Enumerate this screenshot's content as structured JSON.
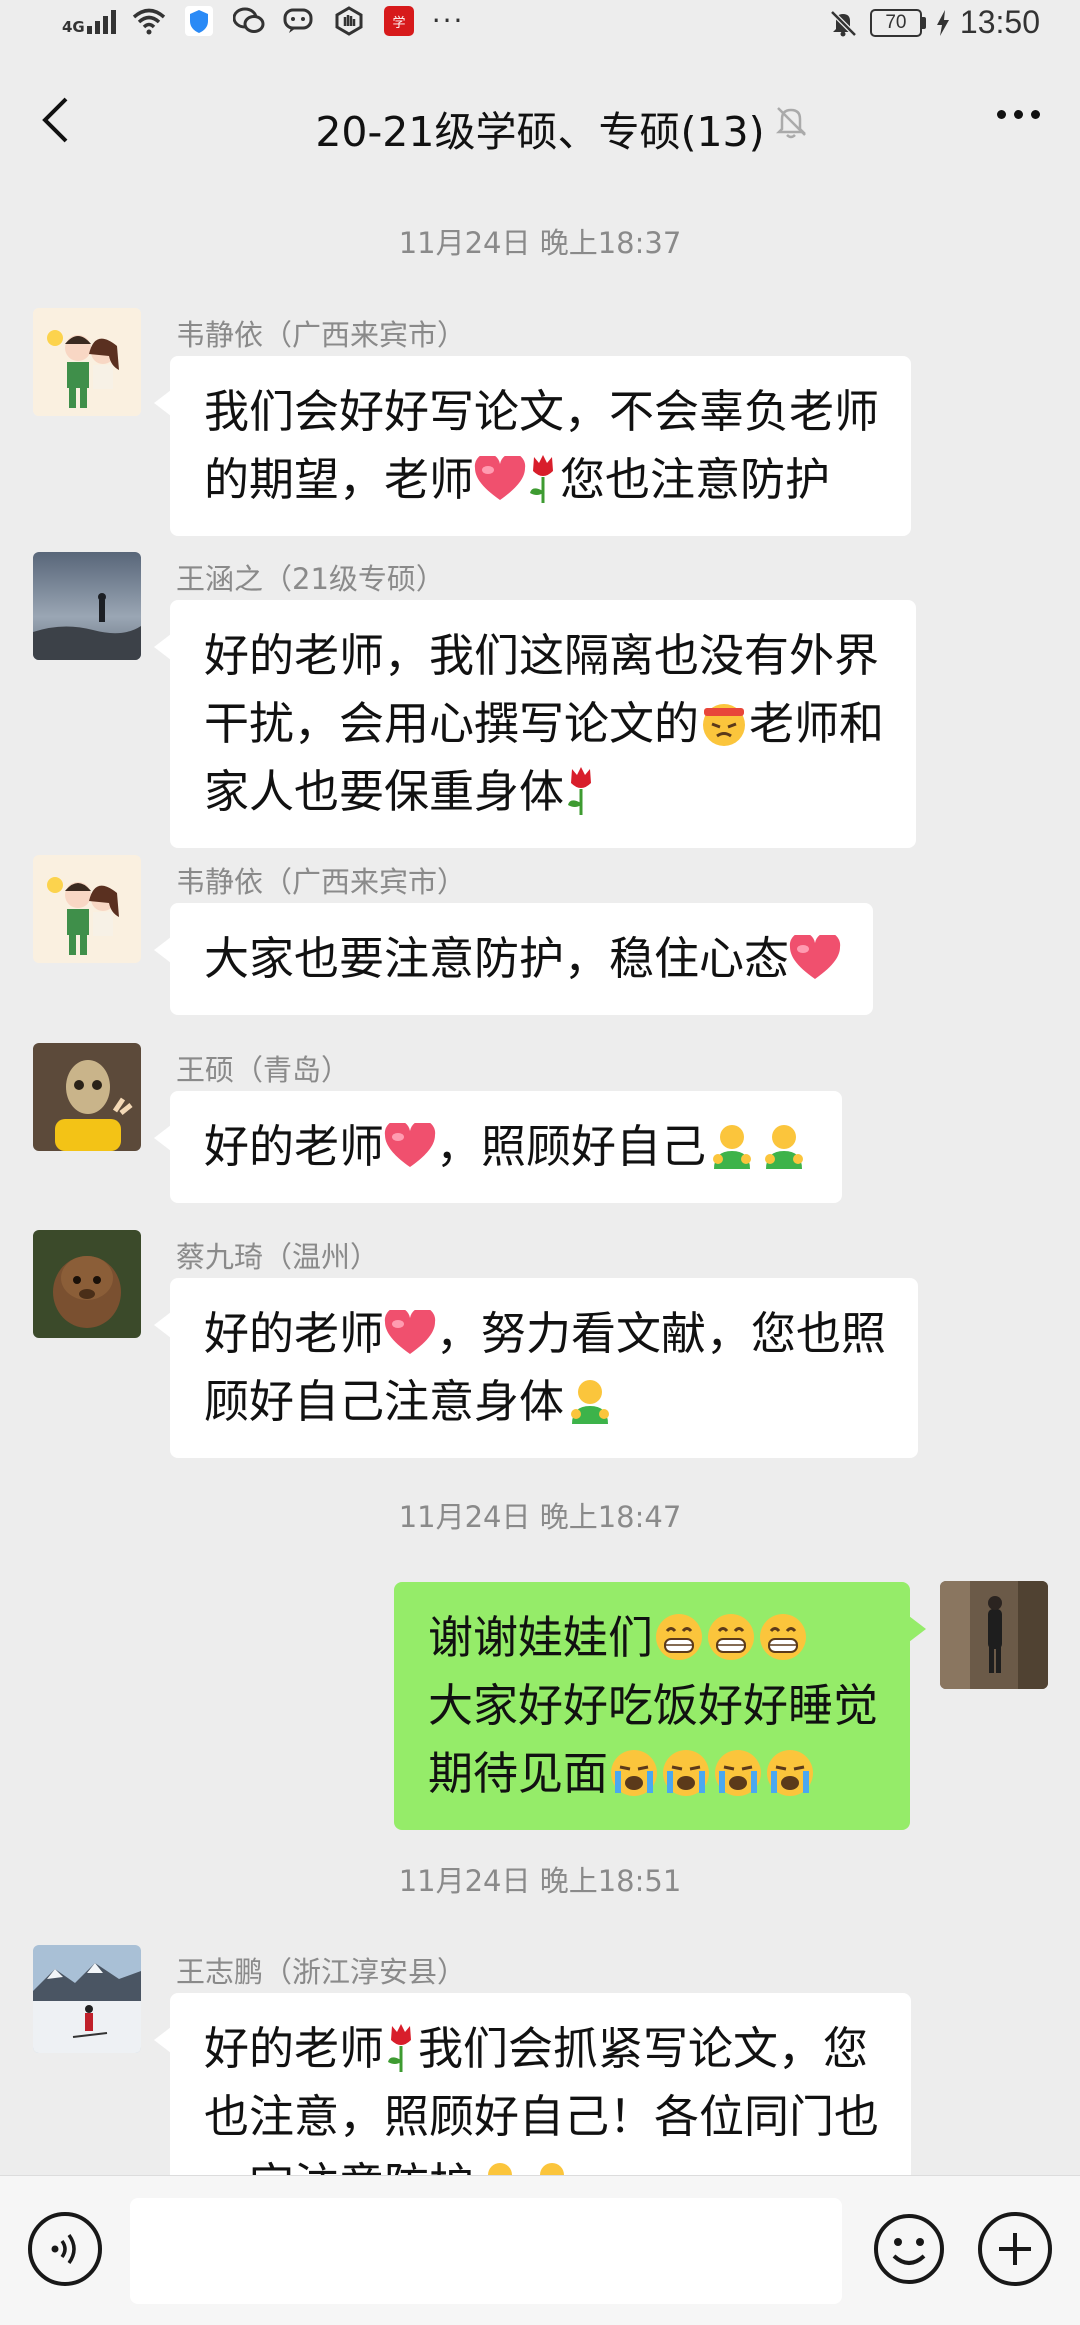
{
  "status_bar": {
    "network": "4G",
    "battery": "70",
    "time": "13:50"
  },
  "header": {
    "title": "20-21级学硕、专硕(13)"
  },
  "timestamps": [
    "11月24日 晚上18:37",
    "11月24日 晚上18:47",
    "11月24日 晚上18:51"
  ],
  "messages": [
    {
      "sender": "韦静依（广西来宾市）",
      "lines": [
        "我们会好好写论文，不会辜负老师",
        [
          "的期望，老师",
          "heart-emoji",
          "rose-emoji",
          "您也注意防护"
        ]
      ]
    },
    {
      "sender": "王涵之（21级专硕）",
      "lines": [
        "好的老师，我们这隔离也没有外界",
        [
          "干扰，会用心撰写论文的",
          "determined-emoji",
          "老师和"
        ],
        [
          "家人也要保重身体",
          "rose-emoji"
        ]
      ]
    },
    {
      "sender": "韦静依（广西来宾市）",
      "lines": [
        [
          "大家也要注意防护，稳住心态",
          "heart-emoji"
        ]
      ]
    },
    {
      "sender": "王硕（青岛）",
      "lines": [
        [
          "好的老师",
          "heart-emoji",
          "，照顾好自己",
          "hug-emoji",
          "hug-emoji"
        ]
      ]
    },
    {
      "sender": "蔡九琦（温州）",
      "lines": [
        [
          "好的老师",
          "heart-emoji",
          "，努力看文献，您也照"
        ],
        [
          "顾好自己注意身体",
          "hug-emoji"
        ]
      ]
    },
    {
      "sender": "",
      "lines": [
        [
          "谢谢娃娃们",
          "grin-emoji",
          "grin-emoji",
          "grin-emoji"
        ],
        "大家好好吃饭好好睡觉",
        [
          "期待见面",
          "cry-emoji",
          "cry-emoji",
          "cry-emoji",
          "cry-emoji"
        ]
      ]
    },
    {
      "sender": "王志鹏（浙江淳安县）",
      "lines": [
        [
          "好的老师",
          "rose-emoji",
          "我们会抓紧写论文，您"
        ],
        "也注意，照顾好自己！各位同门也",
        [
          "一定注意防护",
          "hug-emoji",
          "hug-emoji"
        ]
      ]
    }
  ],
  "input_bar": {
    "placeholder": ""
  },
  "colors": {
    "background": "#ededed",
    "self_bubble": "#95ec69",
    "other_bubble": "#ffffff",
    "meta_text": "#8a8a8a"
  },
  "icons": [
    "back-arrow-icon",
    "mute-bell-icon",
    "more-icon",
    "voice-icon",
    "emoji-icon",
    "plus-icon"
  ]
}
